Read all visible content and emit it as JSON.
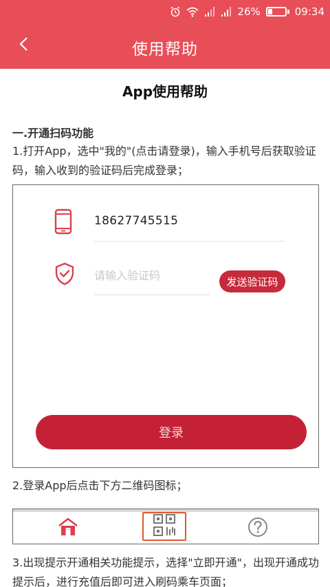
{
  "status_bar": {
    "battery": "26%",
    "time": "09:34",
    "battery_level": 0.26
  },
  "header": {
    "title": "使用帮助"
  },
  "content": {
    "doc_title": "App使用帮助",
    "section_heading": "一.开通扫码功能",
    "step1": "1.打开App，选中\"我的\"(点击请登录)，输入手机号后获取验证码，输入收到的验证码后完成登录；",
    "login_screenshot": {
      "phone_value": "18627745515",
      "code_placeholder": "请输入验证码",
      "send_code_label": "发送验证码",
      "login_label": "登录"
    },
    "step2": "2.登录App后点击下方二维码图标；",
    "step3": "3.出现提示开通相关功能提示，选择\"立即开通\"，出现开通成功提示后，进行充值后即可进入刷码乘车页面；"
  },
  "colors": {
    "header": "#e84e57",
    "icon_red": "#d8414d",
    "button_red": "#c42136",
    "highlight": "#e4572e"
  },
  "icons": [
    "alarm-icon",
    "wifi-icon",
    "signal-icon",
    "battery-icon",
    "back-arrow-icon",
    "phone-icon",
    "shield-check-icon",
    "home-icon",
    "qr-code-icon",
    "help-icon"
  ]
}
